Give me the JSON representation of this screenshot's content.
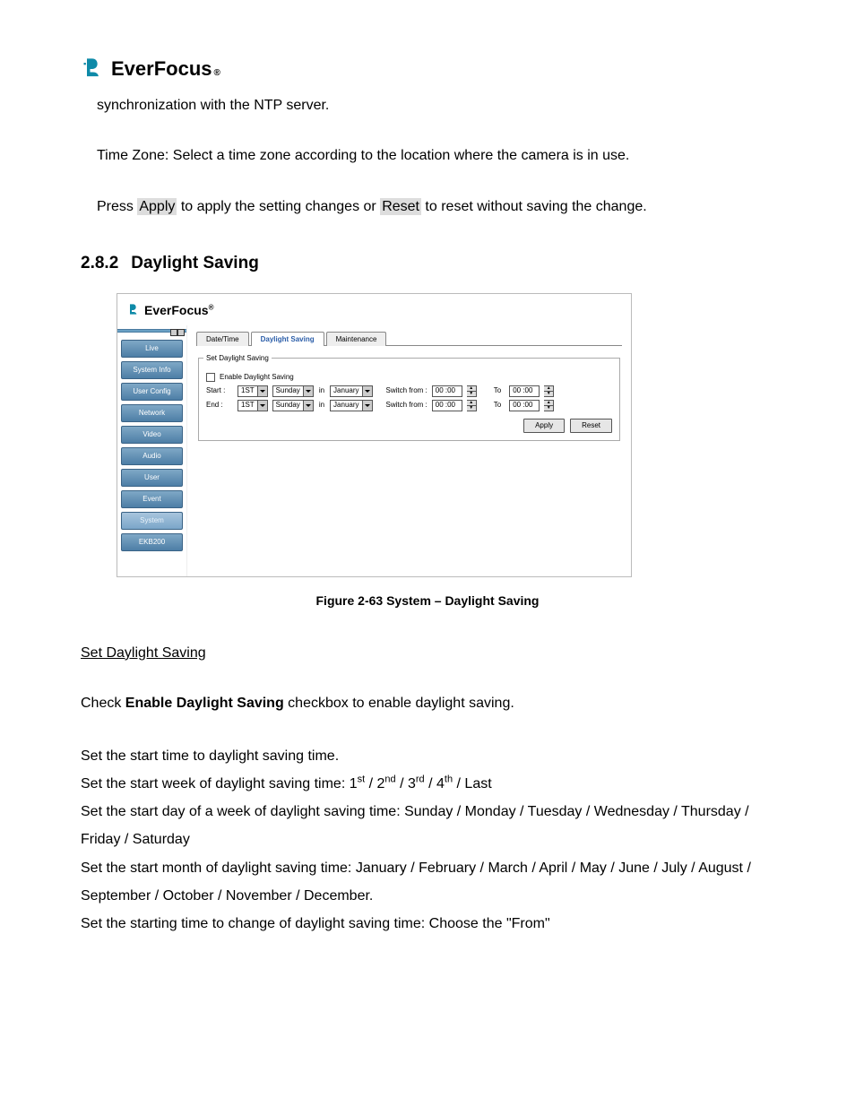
{
  "brand": {
    "name": "EverFocus",
    "reg": "®"
  },
  "intro": {
    "p1": "synchronization with the NTP server.",
    "p2": "Time Zone: Select a time zone according to the location where the camera is in use.",
    "p3a": "Press ",
    "p3_apply": "Apply",
    "p3b": " to apply the setting changes or ",
    "p3_reset": "Reset",
    "p3c": " to reset without saving the change."
  },
  "section": {
    "number": "2.8.2",
    "title": "Daylight Saving"
  },
  "screenshot": {
    "brand": "EverFocus",
    "reg": "®",
    "sidebar": {
      "items": [
        {
          "label": "Live",
          "active": false
        },
        {
          "label": "System Info",
          "active": false
        },
        {
          "label": "User Config",
          "active": false
        },
        {
          "label": "Network",
          "active": false
        },
        {
          "label": "Video",
          "active": false
        },
        {
          "label": "Audio",
          "active": false
        },
        {
          "label": "User",
          "active": false
        },
        {
          "label": "Event",
          "active": false
        },
        {
          "label": "System",
          "active": true
        },
        {
          "label": "EKB200",
          "active": false
        }
      ]
    },
    "tabs": [
      {
        "label": "Date/Time",
        "active": false
      },
      {
        "label": "Daylight Saving",
        "active": true
      },
      {
        "label": "Maintenance",
        "active": false
      }
    ],
    "fieldset": {
      "legend": "Set Daylight Saving",
      "enable_label": "Enable Daylight Saving",
      "rows": [
        {
          "lbl": "Start :",
          "week": "1ST",
          "day": "Sunday",
          "in": "in",
          "month": "January",
          "switch": "Switch from :",
          "time1": "00 :00",
          "to": "To",
          "time2": "00 :00"
        },
        {
          "lbl": "End :",
          "week": "1ST",
          "day": "Sunday",
          "in": "in",
          "month": "January",
          "switch": "Switch from :",
          "time1": "00 :00",
          "to": "To",
          "time2": "00 :00"
        }
      ],
      "apply": "Apply",
      "reset": "Reset"
    }
  },
  "figure_caption": "Figure 2-63 System – Daylight Saving",
  "subhead": "Set Daylight Saving",
  "body": {
    "p1a": "Check ",
    "p1b": "Enable Daylight Saving",
    "p1c": " checkbox to enable daylight saving.",
    "p2": "Set the start time to daylight saving time.",
    "p3a": "Set the start week of daylight saving time: 1",
    "p3s1": "st",
    "p3b": " / 2",
    "p3s2": "nd",
    "p3c": " / 3",
    "p3s3": "rd",
    "p3d": " / 4",
    "p3s4": "th",
    "p3e": " / Last",
    "p4": "Set the start day of a week of daylight saving time: Sunday / Monday / Tuesday / Wednesday / Thursday / Friday / Saturday",
    "p5": "Set the start month of daylight saving time: January / February / March / April / May / June / July / August / September / October / November / December.",
    "p6": "Set the starting time to change of daylight saving time: Choose the \"From\""
  }
}
